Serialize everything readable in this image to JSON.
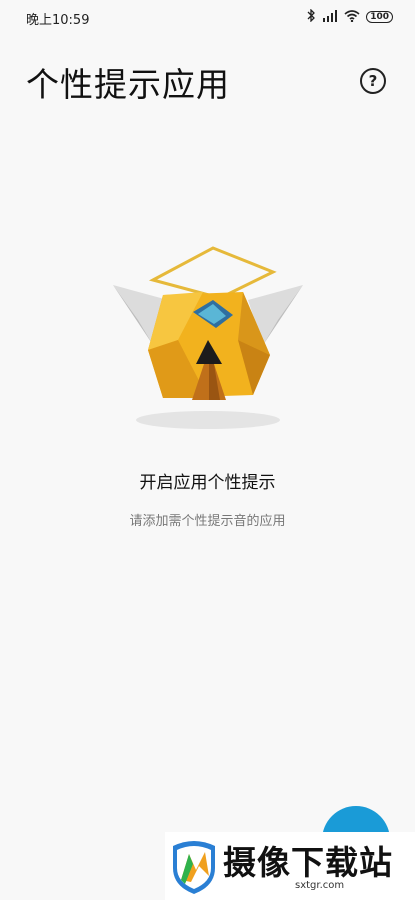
{
  "status_bar": {
    "time": "晚上10:59",
    "battery": "100",
    "icons": [
      "bluetooth-icon",
      "signal-icon",
      "wifi-icon",
      "battery-icon"
    ]
  },
  "header": {
    "title": "个性提示应用",
    "help_icon": "question-circle-icon"
  },
  "empty_state": {
    "title": "开启应用个性提示",
    "subtitle": "请添加需个性提示音的应用"
  },
  "fab": {
    "icon": "add-icon",
    "color": "#1a9bd7"
  },
  "watermark": {
    "text": "摄像下载站",
    "url": "sxtgr.com"
  }
}
